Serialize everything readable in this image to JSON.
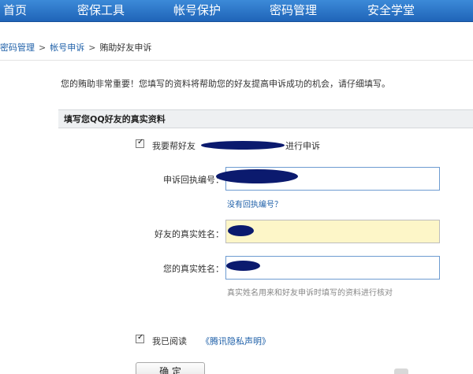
{
  "nav": {
    "items": [
      {
        "label": "首页"
      },
      {
        "label": "密保工具"
      },
      {
        "label": "帐号保护"
      },
      {
        "label": "密码管理"
      },
      {
        "label": "安全学堂"
      }
    ]
  },
  "breadcrumb": {
    "items": [
      "密码管理",
      "帐号申诉",
      "贿助好友申诉"
    ],
    "separator": ">"
  },
  "intro_text": "您的贿助非常重要！您填写的资料将帮助您的好友提高申诉成功的机会，请仔细填写。",
  "section_title": "填写您QQ好友的真实资料",
  "form": {
    "help_prefix": "我要帮好友",
    "help_suffix": "进行申诉",
    "help_checked": true,
    "receipt_label": "申诉回执编号：",
    "receipt_value": "",
    "no_receipt_link": "没有回执编号？",
    "friend_name_label": "好友的真实姓名：",
    "friend_name_value": "",
    "your_name_label": "您的真实姓名：",
    "your_name_value": "",
    "name_hint": "真实姓名用来和好友申诉时填写的资料进行核对",
    "agree_text": "我已阅读",
    "agree_link": "《腾讯隐私声明》",
    "agree_checked": true,
    "confirm_label": "确 定"
  },
  "colors": {
    "nav_bg": "#2a74c8",
    "link": "#1d5fa8",
    "input_border": "#6d9bd1",
    "input_highlight_bg": "#fdf6c8",
    "section_bg": "#eef0f2",
    "redaction": "#0b1a6e"
  }
}
